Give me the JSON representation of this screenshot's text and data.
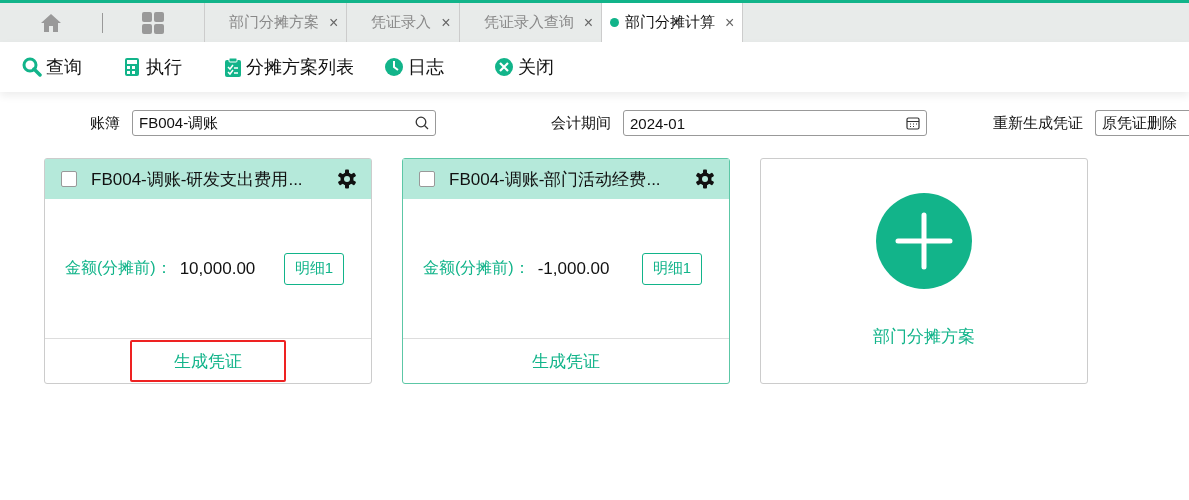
{
  "tabs": [
    {
      "kind": "home",
      "selected": false
    },
    {
      "kind": "apps",
      "selected": false
    },
    {
      "kind": "page",
      "label": "部门分摊方案",
      "close": "×",
      "selected": false
    },
    {
      "kind": "page",
      "label": "凭证录入",
      "close": "×",
      "selected": false
    },
    {
      "kind": "page",
      "label": "凭证录入查询",
      "close": "×",
      "selected": false
    },
    {
      "kind": "page",
      "label": "部门分摊计算",
      "close": "×",
      "selected": true
    }
  ],
  "toolbar": [
    {
      "kind": "search",
      "label": "查询"
    },
    {
      "kind": "calc",
      "label": "执行"
    },
    {
      "kind": "clipboard",
      "label": "分摊方案列表"
    },
    {
      "kind": "clock",
      "label": "日志"
    },
    {
      "kind": "close",
      "label": "关闭"
    }
  ],
  "filters": [
    {
      "label": "账簿",
      "value": "FB004-调账",
      "kind": "search"
    },
    {
      "label": "会计期间",
      "value": "2024-01",
      "kind": "date"
    },
    {
      "label": "重新生成凭证",
      "value": "原凭证删除",
      "kind": "select"
    }
  ],
  "cards": [
    {
      "title": "FB004-调账-研发支出费用...",
      "checked": false,
      "active": false,
      "amount_label": "金额(分摊前)：",
      "amount": "10,000.00",
      "detail": "明细1",
      "action": "生成凭证",
      "highlighted": true
    },
    {
      "title": "FB004-调账-部门活动经费...",
      "checked": false,
      "active": true,
      "amount_label": "金额(分摊前)：",
      "amount": "-1,000.00",
      "detail": "明细1",
      "action": "生成凭证",
      "highlighted": false
    }
  ],
  "add_card": {
    "label": "部门分摊方案"
  }
}
